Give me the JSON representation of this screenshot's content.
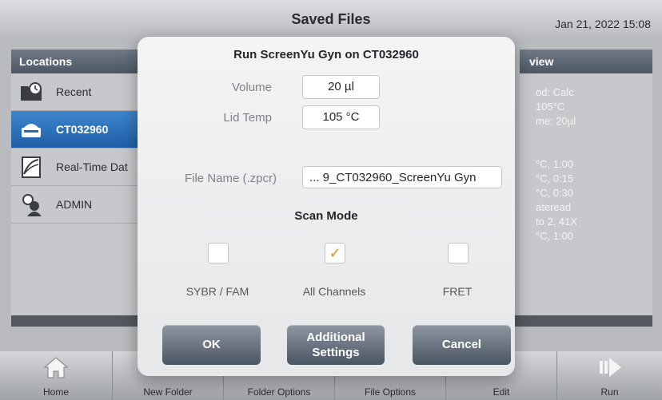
{
  "header": {
    "title": "Saved Files",
    "datetime": "Jan 21, 2022 15:08"
  },
  "locations": {
    "header": "Locations",
    "items": [
      {
        "label": "Recent",
        "icon": "folder-clock-icon"
      },
      {
        "label": "CT032960",
        "icon": "instrument-icon",
        "selected": true
      },
      {
        "label": "Real-Time Dat",
        "icon": "realtime-data-icon"
      },
      {
        "label": "ADMIN",
        "icon": "user-icon"
      }
    ]
  },
  "overview": {
    "header": "view",
    "lines": [
      "od: Calc",
      "105°C",
      "me: 20µl",
      "°C, 1:00",
      "°C, 0:15",
      "°C, 0:30",
      "ateread",
      "to 2, 41X",
      "°C, 1:00"
    ]
  },
  "dialog": {
    "title": "Run ScreenYu Gyn on CT032960",
    "volume_label": "Volume",
    "volume_value": "20 µl",
    "lid_temp_label": "Lid Temp",
    "lid_temp_value": "105 °C",
    "file_name_label": "File Name (.zpcr)",
    "file_name_value": "... 9_CT032960_ScreenYu Gyn",
    "scan_mode_label": "Scan Mode",
    "scan_options": [
      {
        "label": "SYBR / FAM",
        "checked": false
      },
      {
        "label": "All Channels",
        "checked": true
      },
      {
        "label": "FRET",
        "checked": false
      }
    ],
    "ok_label": "OK",
    "additional_settings_line1": "Additional",
    "additional_settings_line2": "Settings",
    "cancel_label": "Cancel"
  },
  "toolbar": {
    "home": "Home",
    "new_folder": "New Folder",
    "folder_options": "Folder Options",
    "file_options": "File Options",
    "edit": "Edit",
    "run": "Run"
  },
  "colors": {
    "accent": "#1f5fa8",
    "checkmark": "#ef8a1a",
    "button": "#4a5562"
  }
}
